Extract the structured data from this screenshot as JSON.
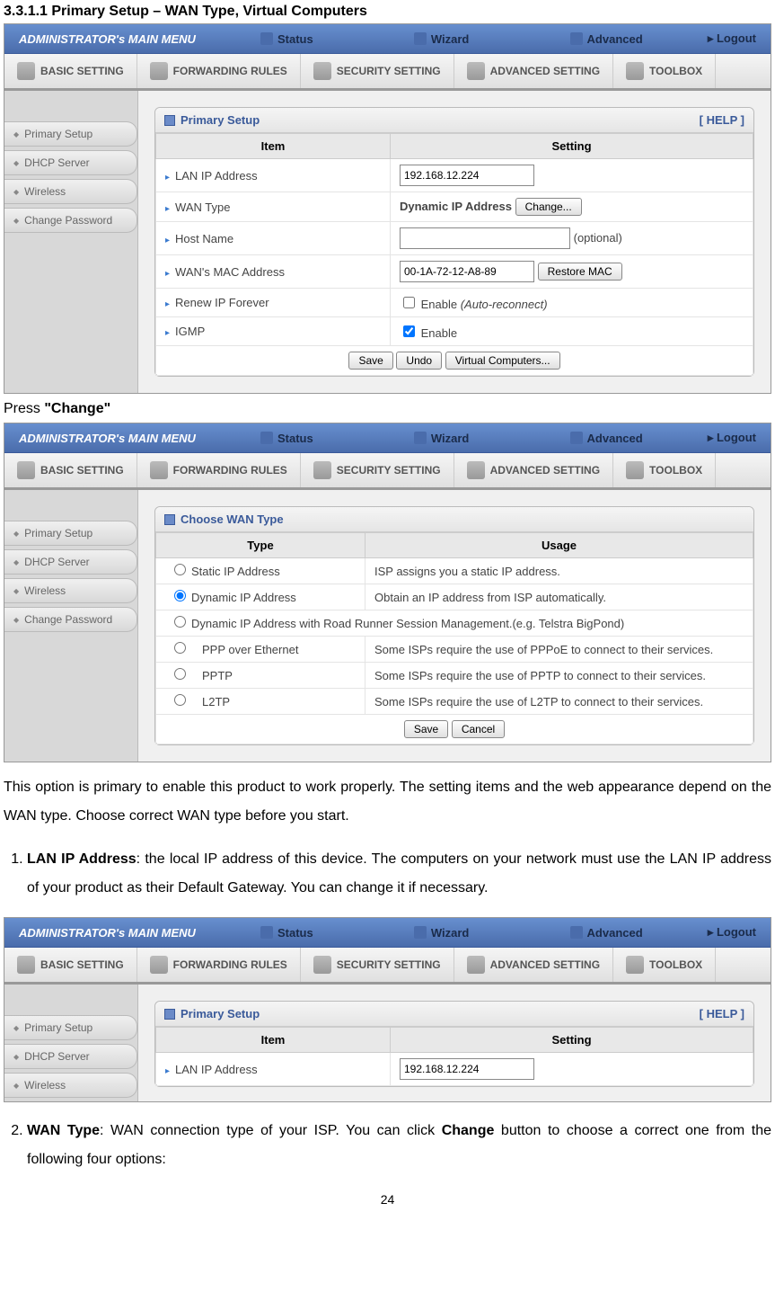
{
  "doc": {
    "section_title": "3.3.1.1 Primary Setup – WAN Type, Virtual Computers",
    "press_label_pre": "Press ",
    "press_label_bold": "\"Change\"",
    "para1": "This option is primary to enable this product to work properly. The setting items and the web appearance depend on the WAN type. Choose correct WAN type before you start.",
    "li1_bold": "LAN IP Address",
    "li1_rest": ": the local IP address of this device. The computers on your network must use the LAN IP address of your product as their Default Gateway. You can change it if necessary.",
    "li2_bold": "WAN Type",
    "li2_rest_a": ": WAN connection type of your ISP. You can click ",
    "li2_rest_change": "Change",
    "li2_rest_b": " button to choose a correct one from the following four options:",
    "page_number": "24"
  },
  "router": {
    "topbar_title": "ADMINISTRATOR's MAIN MENU",
    "nav": {
      "status": "Status",
      "wizard": "Wizard",
      "advanced": "Advanced"
    },
    "logout": "Logout",
    "tabs": {
      "basic": "BASIC SETTING",
      "forwarding": "FORWARDING RULES",
      "security": "SECURITY SETTING",
      "advanced": "ADVANCED SETTING",
      "toolbox": "TOOLBOX"
    },
    "sidebar": {
      "primary": "Primary Setup",
      "dhcp": "DHCP Server",
      "wireless": "Wireless",
      "changepw": "Change Password"
    }
  },
  "panel1": {
    "title": "Primary Setup",
    "help": "[ HELP ]",
    "col_item": "Item",
    "col_setting": "Setting",
    "rows": {
      "lan_ip": "LAN IP Address",
      "wan_type": "WAN Type",
      "host_name": "Host Name",
      "wan_mac": "WAN's MAC Address",
      "renew_ip": "Renew IP Forever",
      "igmp": "IGMP"
    },
    "vals": {
      "lan_ip": "192.168.12.224",
      "wan_type_text": "Dynamic IP Address",
      "change_btn": "Change...",
      "host_optional": "(optional)",
      "wan_mac": "00-1A-72-12-A8-89",
      "restore_mac": "Restore MAC",
      "renew_label": "Enable ",
      "renew_italic": "(Auto-reconnect)",
      "igmp_label": "Enable"
    },
    "btns": {
      "save": "Save",
      "undo": "Undo",
      "virtual": "Virtual Computers..."
    }
  },
  "panel2": {
    "title": "Choose WAN Type",
    "col_type": "Type",
    "col_usage": "Usage",
    "rows": {
      "static": {
        "type": "Static IP Address",
        "usage": "ISP assigns you a static IP address."
      },
      "dynamic": {
        "type": "Dynamic IP Address",
        "usage": "Obtain an IP address from ISP automatically."
      },
      "rr": {
        "type": "Dynamic IP Address with Road Runner Session Management.(e.g. Telstra BigPond)",
        "usage": ""
      },
      "pppoe": {
        "type": "PPP over Ethernet",
        "usage": "Some ISPs require the use of PPPoE to connect to their services."
      },
      "pptp": {
        "type": "PPTP",
        "usage": "Some ISPs require the use of PPTP to connect to their services."
      },
      "l2tp": {
        "type": "L2TP",
        "usage": "Some ISPs require the use of L2TP to connect to their services."
      }
    },
    "btns": {
      "save": "Save",
      "cancel": "Cancel"
    }
  },
  "panel3": {
    "title": "Primary Setup",
    "help": "[ HELP ]",
    "col_item": "Item",
    "col_setting": "Setting",
    "row_lan_ip": "LAN IP Address",
    "val_lan_ip": "192.168.12.224"
  }
}
